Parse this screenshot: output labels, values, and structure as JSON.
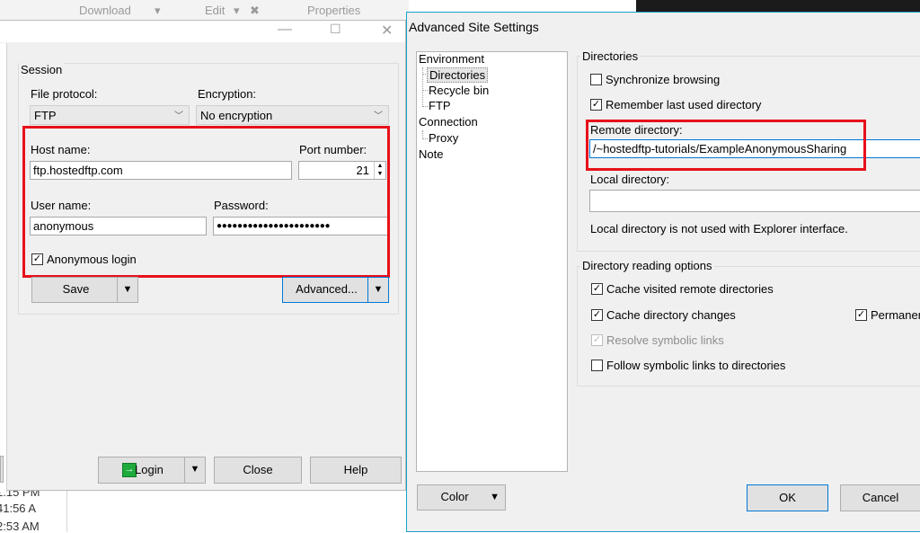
{
  "background": {
    "toolbar": {
      "download": "Download",
      "edit": "Edit",
      "properties": "Properties"
    },
    "times": [
      "2:15 PM",
      "41:56 A",
      "2:53 AM"
    ]
  },
  "login": {
    "session_label": "Session",
    "file_protocol_label": "File protocol:",
    "file_protocol_value": "FTP",
    "encryption_label": "Encryption:",
    "encryption_value": "No encryption",
    "host_label": "Host name:",
    "host_value": "ftp.hostedftp.com",
    "port_label": "Port number:",
    "port_value": "21",
    "user_label": "User name:",
    "user_value": "anonymous",
    "password_label": "Password:",
    "password_value": "●●●●●●●●●●●●●●●●●●●●●●",
    "anonymous_label": "Anonymous login",
    "save_label": "Save",
    "advanced_label": "Advanced...",
    "login_label": "Login",
    "close_label": "Close",
    "help_label": "Help"
  },
  "advanced": {
    "title": "Advanced Site Settings",
    "tree": {
      "environment": "Environment",
      "directories": "Directories",
      "recycle_bin": "Recycle bin",
      "ftp": "FTP",
      "connection": "Connection",
      "proxy": "Proxy",
      "note": "Note"
    },
    "directories_group": "Directories",
    "sync_browsing": "Synchronize browsing",
    "remember_last": "Remember last used directory",
    "remote_dir_label": "Remote directory:",
    "remote_dir_value": "/~hostedftp-tutorials/ExampleAnonymousSharing",
    "local_dir_label": "Local directory:",
    "local_dir_value": "",
    "local_dir_note": "Local directory is not used with Explorer interface.",
    "reading_group": "Directory reading options",
    "cache_visited": "Cache visited remote directories",
    "cache_changes": "Cache directory changes",
    "permanent": "Permanen",
    "resolve_links": "Resolve symbolic links",
    "follow_links": "Follow symbolic links to directories",
    "color_label": "Color",
    "ok_label": "OK",
    "cancel_label": "Cancel"
  },
  "colors": {
    "highlight": "#e8101a",
    "focus_border": "#0078d7",
    "dialog_border": "#18a0c8",
    "login_icon": "#1faa3c"
  },
  "icons": [
    "maximize-icon",
    "close-icon",
    "chevron-down-icon",
    "login-icon",
    "checkmark-icon"
  ]
}
